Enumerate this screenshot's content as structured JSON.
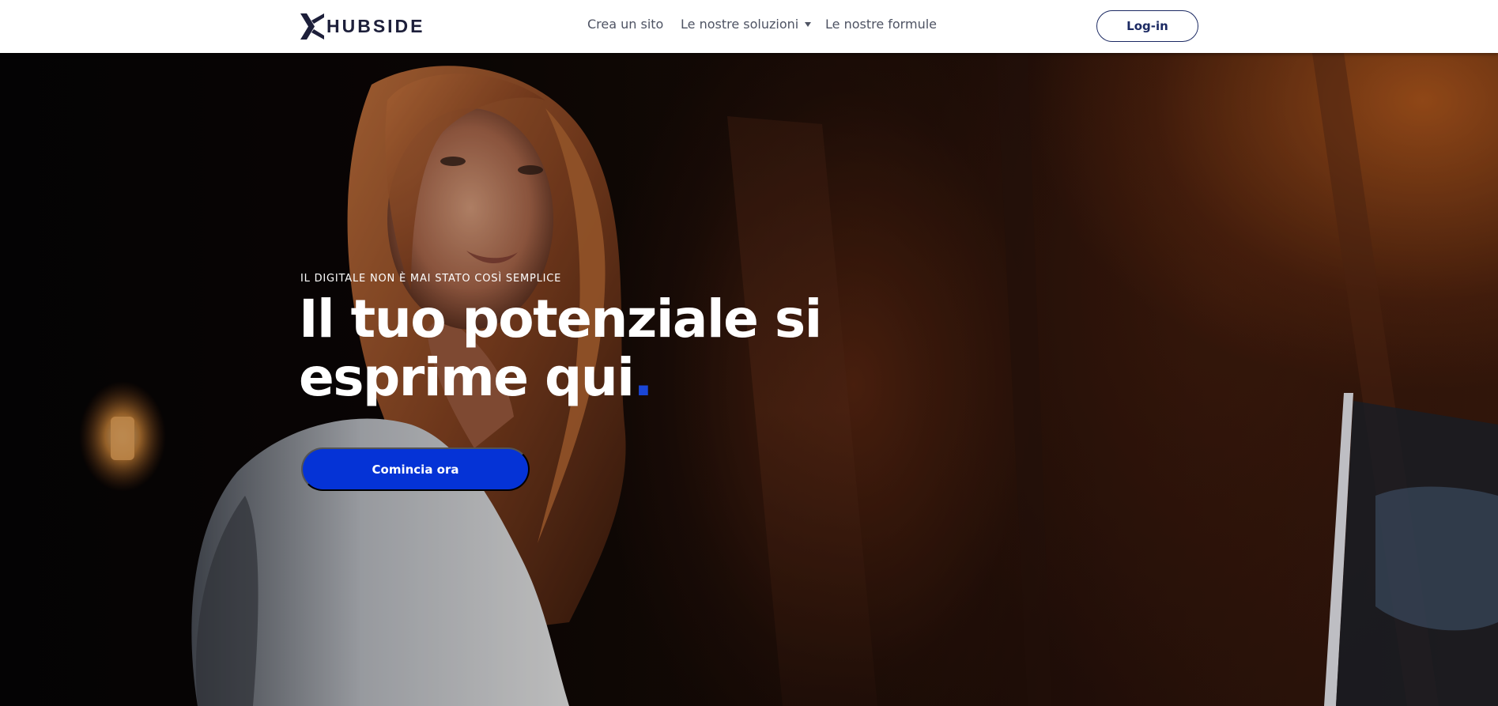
{
  "header": {
    "logo_text": "HUBSIDE",
    "nav": {
      "crea": "Crea un sito",
      "soluzioni": "Le nostre soluzioni",
      "formule": "Le nostre formule"
    },
    "login_label": "Log-in"
  },
  "hero": {
    "kicker": "IL DIGITALE NON È MAI STATO COSÌ SEMPLICE",
    "title_line1": "Il tuo potenziale si",
    "title_line2": "esprime qui",
    "title_dot": ".",
    "cta_label": "Comincia ora"
  },
  "colors": {
    "accent": "#0533d6",
    "brand_navy": "#1c2a63",
    "header_bg": "#ffffff",
    "nav_text": "#4e5363"
  },
  "icons": {
    "logo_mark": "hubside-x-logo-icon",
    "dropdown": "chevron-down-icon"
  }
}
